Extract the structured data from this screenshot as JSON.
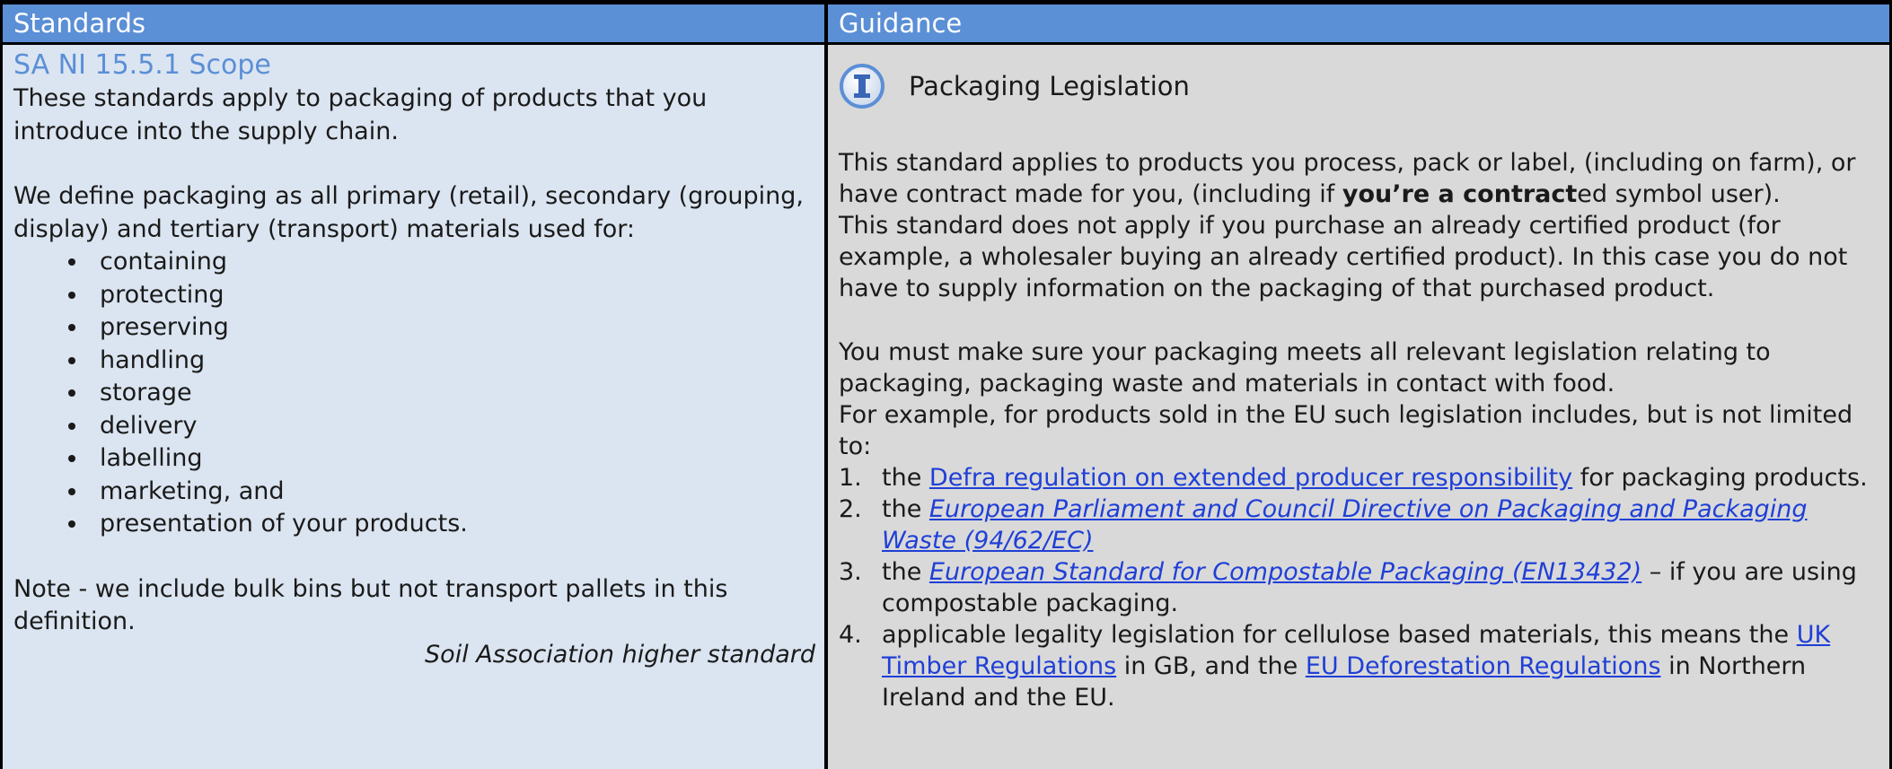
{
  "header": {
    "standards": "Standards",
    "guidance": "Guidance"
  },
  "standards": {
    "scope_title": "SA NI 15.5.1 Scope",
    "intro": "These standards apply to packaging of products that you introduce into the supply chain.",
    "definition": "We define packaging as all primary (retail), secondary (grouping, display) and tertiary (transport) materials used for:",
    "bullets": [
      "containing",
      "protecting",
      "preserving",
      "handling",
      "storage",
      "delivery",
      "labelling",
      "marketing, and",
      "presentation of your products."
    ],
    "note": "Note - we include bulk bins but not transport pallets in this definition.",
    "higher_standard": "Soil Association higher standard"
  },
  "guidance": {
    "icon": "info-icon",
    "title": "Packaging Legislation",
    "p1_a": "This standard applies to products you process, pack or label, (including on farm), or have contract made for you, (including if ",
    "p1_bold": "you’re a contract",
    "p1_b": "ed symbol user).",
    "p2": "This standard does not apply if you purchase an already certified product (for example, a wholesaler buying an already certified product). In this case you do not have to supply information on the packaging of that purchased product.",
    "p3": "You must make sure your packaging meets all relevant legislation relating to packaging, packaging waste and materials in contact with food.",
    "p4": "For example, for products sold in the EU such legislation includes, but is not limited to:",
    "items": [
      {
        "num": "1.",
        "pre": "the ",
        "link": "Defra regulation on extended producer responsibility",
        "post": " for packaging products."
      },
      {
        "num": "2.",
        "pre": "the ",
        "link": "European Parliament and Council Directive on Packaging and Packaging Waste (94/62/EC)",
        "post": ""
      },
      {
        "num": "3.",
        "pre": "the ",
        "link": "European Standard for Compostable Packaging (EN13432)",
        "post": " – if you are using compostable packaging."
      },
      {
        "num": "4.",
        "pre": "applicable legality legislation for cellulose based materials, this means the ",
        "link": "UK Timber Regulations",
        "mid": " in GB, and the ",
        "link2": "EU Deforestation Regulations",
        "post": " in Northern Ireland and the EU."
      }
    ]
  },
  "colors": {
    "header_bg": "#5b8fd6",
    "left_bg": "#dbe5f1",
    "right_bg": "#d9d9d9",
    "link": "#1f3fd6"
  }
}
